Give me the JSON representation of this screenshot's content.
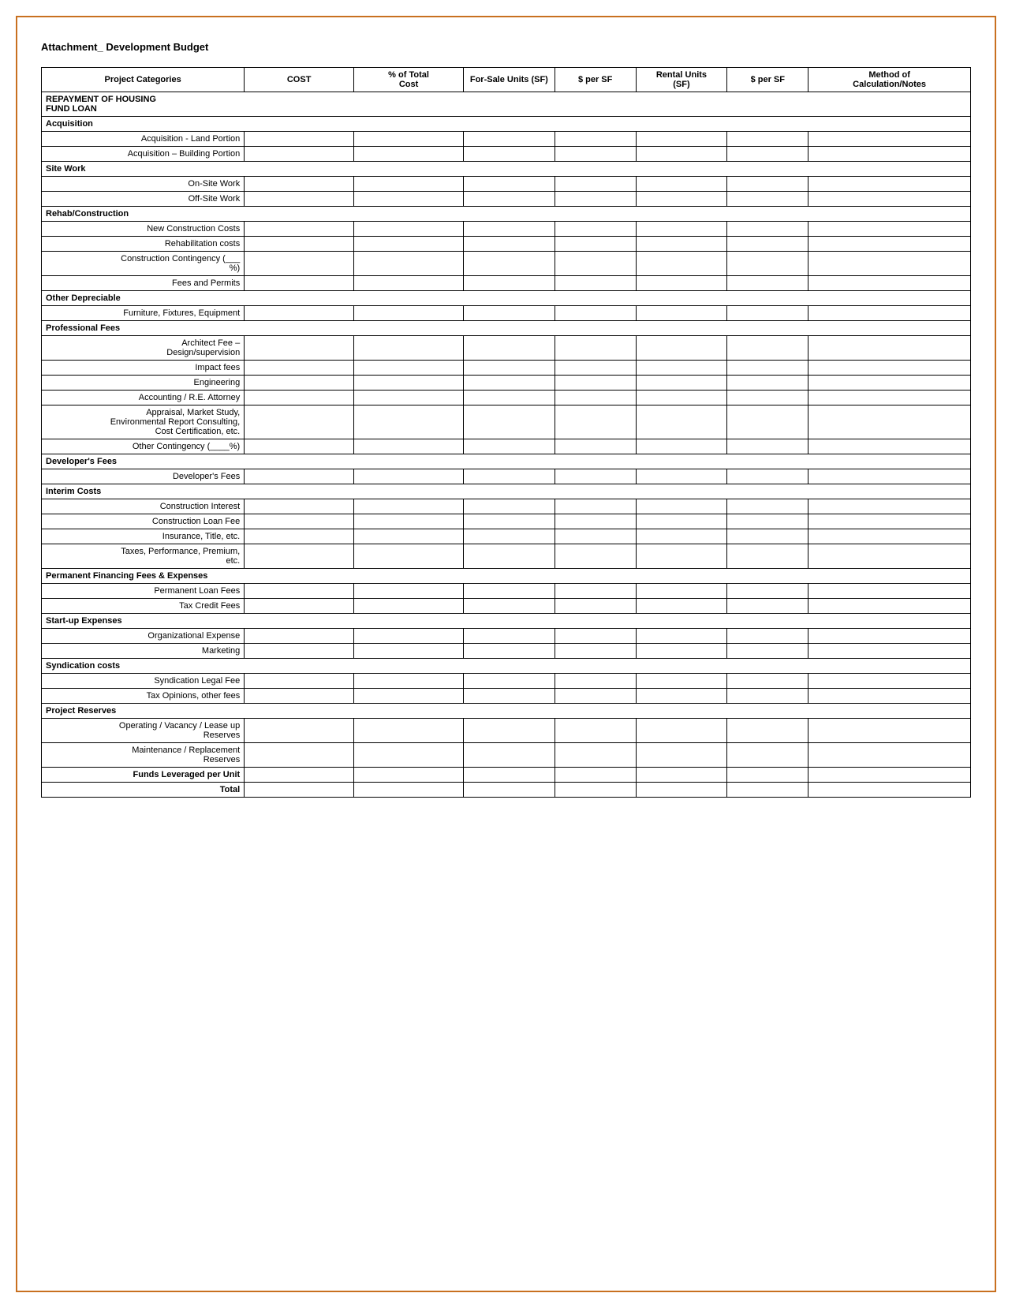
{
  "page": {
    "title": "Attachment_ Development Budget"
  },
  "table": {
    "headers": {
      "project_categories": "Project Categories",
      "cost": "COST",
      "pct_total_cost": "% of Total Cost",
      "for_sale_units": "For-Sale Units (SF)",
      "per_sf_1": "$ per SF",
      "rental_units": "Rental Units (SF)",
      "per_sf_2": "$ per SF",
      "method": "Method of Calculation/Notes"
    },
    "rows": [
      {
        "type": "section",
        "label": "REPAYMENT OF HOUSING FUND LOAN",
        "bold": true
      },
      {
        "type": "section",
        "label": "Acquisition"
      },
      {
        "type": "data",
        "label": "Acquisition - Land Portion"
      },
      {
        "type": "data",
        "label": "Acquisition – Building Portion"
      },
      {
        "type": "section",
        "label": "Site Work"
      },
      {
        "type": "data",
        "label": "On-Site Work"
      },
      {
        "type": "data",
        "label": "Off-Site Work"
      },
      {
        "type": "section",
        "label": "Rehab/Construction"
      },
      {
        "type": "data",
        "label": "New Construction Costs"
      },
      {
        "type": "data",
        "label": "Rehabilitation costs"
      },
      {
        "type": "data",
        "label": "Construction Contingency (___\n%)"
      },
      {
        "type": "data",
        "label": "Fees and Permits"
      },
      {
        "type": "section",
        "label": "Other Depreciable"
      },
      {
        "type": "data",
        "label": "Furniture, Fixtures, Equipment"
      },
      {
        "type": "section",
        "label": "Professional Fees"
      },
      {
        "type": "data",
        "label": "Architect Fee –\nDesign/supervision"
      },
      {
        "type": "data",
        "label": "Impact fees"
      },
      {
        "type": "data",
        "label": "Engineering"
      },
      {
        "type": "data",
        "label": "Accounting / R.E. Attorney"
      },
      {
        "type": "data",
        "label": "Appraisal, Market Study,\nEnvironmental Report Consulting,\nCost Certification, etc."
      },
      {
        "type": "data",
        "label": "Other Contingency (____%)"
      },
      {
        "type": "section",
        "label": "Developer's Fees"
      },
      {
        "type": "data",
        "label": "Developer's Fees"
      },
      {
        "type": "section",
        "label": "Interim Costs"
      },
      {
        "type": "data",
        "label": "Construction Interest"
      },
      {
        "type": "data",
        "label": "Construction Loan Fee"
      },
      {
        "type": "data",
        "label": "Insurance, Title, etc."
      },
      {
        "type": "data",
        "label": "Taxes, Performance, Premium,\netc."
      },
      {
        "type": "section",
        "label": "Permanent Financing Fees & Expenses"
      },
      {
        "type": "data",
        "label": "Permanent Loan Fees"
      },
      {
        "type": "data",
        "label": "Tax Credit Fees"
      },
      {
        "type": "section",
        "label": "Start-up Expenses"
      },
      {
        "type": "data",
        "label": "Organizational Expense"
      },
      {
        "type": "data",
        "label": "Marketing"
      },
      {
        "type": "section",
        "label": "Syndication costs"
      },
      {
        "type": "data",
        "label": "Syndication Legal Fee"
      },
      {
        "type": "data",
        "label": "Tax Opinions, other fees"
      },
      {
        "type": "section",
        "label": "Project Reserves"
      },
      {
        "type": "data",
        "label": "Operating / Vacancy /  Lease up\nReserves"
      },
      {
        "type": "data",
        "label": "Maintenance / Replacement\nReserves"
      },
      {
        "type": "bold-data",
        "label": "Funds Leveraged per Unit"
      },
      {
        "type": "bold-data",
        "label": "Total"
      }
    ]
  }
}
